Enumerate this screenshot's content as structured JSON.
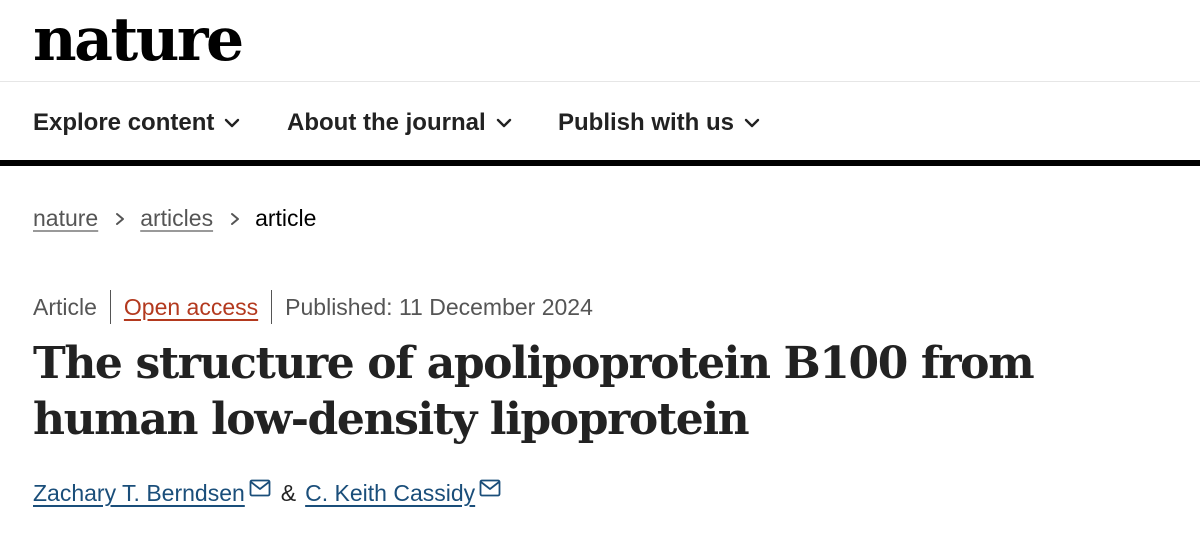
{
  "header": {
    "logo": "nature"
  },
  "nav": {
    "items": [
      {
        "label": "Explore content",
        "icon": "chevron-down-icon"
      },
      {
        "label": "About the journal",
        "icon": "chevron-down-icon"
      },
      {
        "label": "Publish with us",
        "icon": "chevron-down-icon"
      }
    ]
  },
  "breadcrumb": {
    "items": [
      {
        "label": "nature"
      },
      {
        "label": "articles"
      },
      {
        "label": "article"
      }
    ]
  },
  "article": {
    "type": "Article",
    "access": "Open access",
    "published": "Published: 11 December 2024",
    "title": "The structure of apolipoprotein B100 from human low-density lipoprotein",
    "authors": [
      {
        "name": "Zachary T. Berndsen",
        "icon": "email-icon"
      },
      {
        "name": "C. Keith Cassidy",
        "icon": "email-icon"
      }
    ],
    "author_joiner": "&"
  },
  "colors": {
    "open_access": "#b3391e",
    "author_link": "#1a4e7a",
    "nav_border": "#000000"
  }
}
